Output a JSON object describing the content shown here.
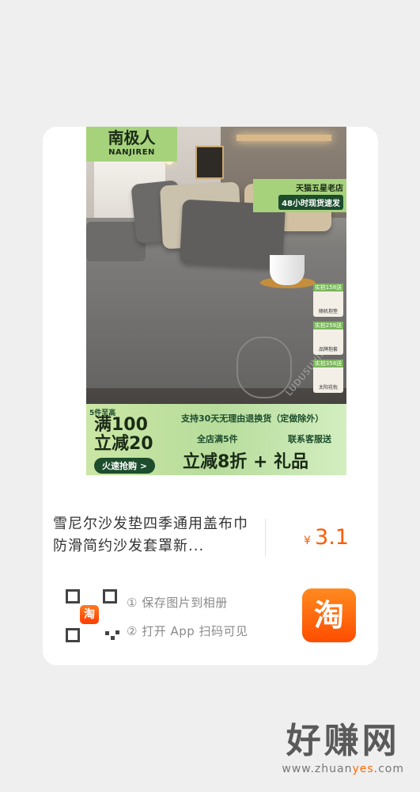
{
  "product": {
    "brand_cn": "南极人",
    "brand_en": "NANJIREN",
    "store_badge": "天猫五星老店",
    "shipping_badge": "48小时现货速发",
    "gifts": [
      {
        "tag": "实拍158送",
        "name": "随机抱垫"
      },
      {
        "tag": "实拍258送",
        "name": "品牌抱套"
      },
      {
        "tag": "实拍358送",
        "name": "太阳花枕"
      }
    ],
    "photo_caption": "LUDUSUVINN",
    "banner": {
      "tier": "5件至高",
      "line1": "满100",
      "line2": "立减20",
      "rush": "火速抢购 >",
      "return_policy": "支持30天无理由退换货（定做除外）",
      "sub_left": "全店满5件",
      "sub_right": "联系客服送",
      "promo": "立减8折 + 礼品"
    },
    "title": "雪尼尔沙发垫四季通用盖布巾防滑简约沙发套罩新...",
    "price_currency": "¥",
    "price_value": "3.1"
  },
  "steps": {
    "step1": "① 保存图片到相册",
    "step2": "② 打开 App 扫码可见"
  },
  "qr_logo": "淘",
  "taobao_button": "淘",
  "watermark": {
    "cn": "好赚网",
    "url_pre": "www.zhuan",
    "url_hl": "yes",
    "url_post": ".com"
  }
}
